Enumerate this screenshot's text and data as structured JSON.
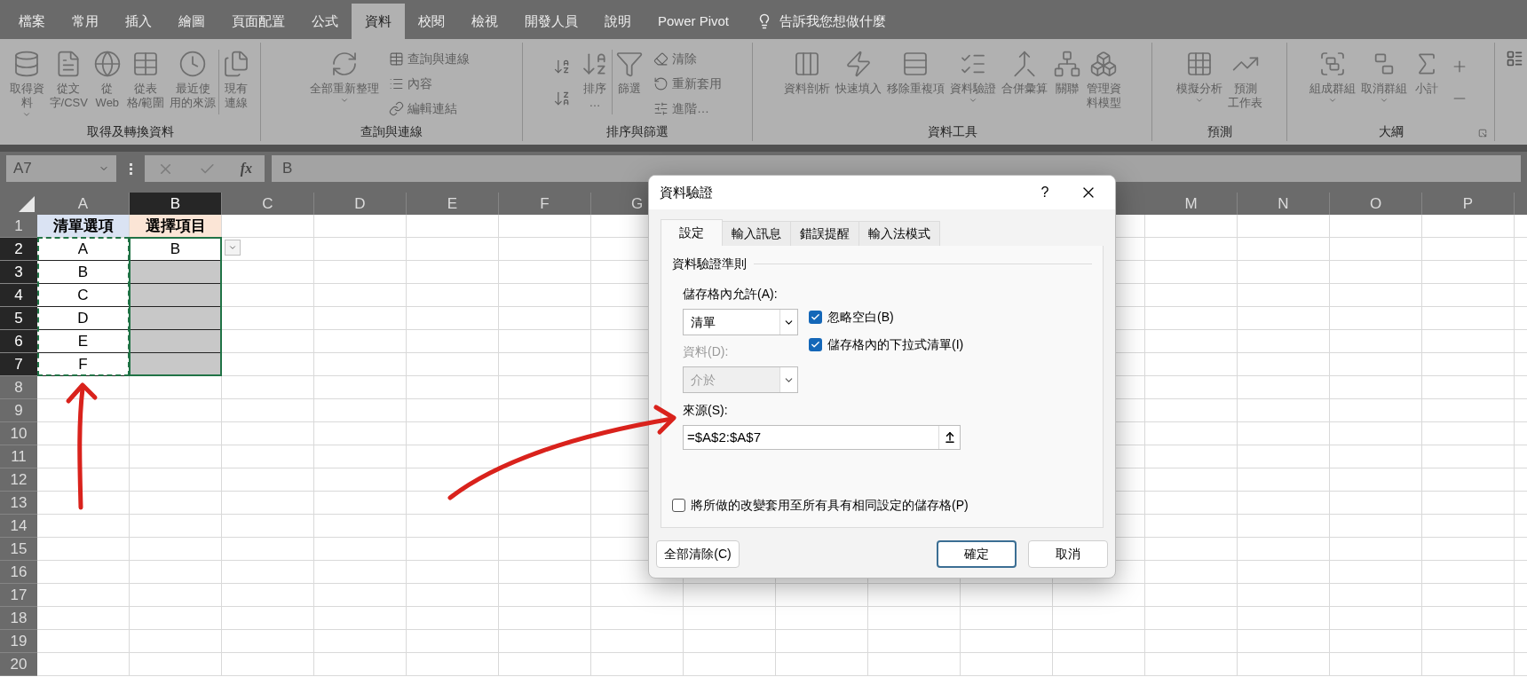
{
  "menu_tabs": [
    {
      "label": "檔案",
      "selected": false
    },
    {
      "label": "常用",
      "selected": false
    },
    {
      "label": "插入",
      "selected": false
    },
    {
      "label": "繪圖",
      "selected": false
    },
    {
      "label": "頁面配置",
      "selected": false
    },
    {
      "label": "公式",
      "selected": false
    },
    {
      "label": "資料",
      "selected": true
    },
    {
      "label": "校閱",
      "selected": false
    },
    {
      "label": "檢視",
      "selected": false
    },
    {
      "label": "開發人員",
      "selected": false
    },
    {
      "label": "說明",
      "selected": false
    },
    {
      "label": "Power Pivot",
      "selected": false
    }
  ],
  "tell_me": "告訴我您想做什麼",
  "ribbon_groups": [
    {
      "label": "取得及轉換資料",
      "launcher": false,
      "items": [
        {
          "kind": "large",
          "lines": [
            "取得資",
            "料"
          ],
          "dropdown": true
        },
        {
          "kind": "large",
          "lines": [
            "從文",
            "字/CSV"
          ],
          "dropdown": false
        },
        {
          "kind": "large",
          "lines": [
            "從",
            "Web"
          ],
          "dropdown": false
        },
        {
          "kind": "large",
          "lines": [
            "從表",
            "格/範圍"
          ],
          "dropdown": false
        },
        {
          "kind": "large",
          "lines": [
            "最近使",
            "用的來源"
          ],
          "dropdown": false
        },
        {
          "kind": "separator"
        },
        {
          "kind": "large",
          "lines": [
            "現有",
            "連線"
          ],
          "dropdown": false
        }
      ]
    },
    {
      "label": "查詢與連線",
      "launcher": false,
      "items": [
        {
          "kind": "large",
          "lines": [
            "全部重新整理"
          ],
          "dropdown": true
        },
        {
          "kind": "stack",
          "entries": [
            "查詢與連線",
            "內容",
            "編輯連結"
          ]
        }
      ]
    },
    {
      "label": "排序與篩選",
      "launcher": false,
      "items": [
        {
          "kind": "icon_stack"
        },
        {
          "kind": "large",
          "lines": [
            "排序",
            "…"
          ],
          "dropdown": false
        },
        {
          "kind": "separator"
        },
        {
          "kind": "large",
          "lines": [
            "篩選"
          ],
          "dropdown": false
        },
        {
          "kind": "stack",
          "entries": [
            "清除",
            "重新套用",
            "進階…"
          ]
        }
      ]
    },
    {
      "label": "資料工具",
      "launcher": false,
      "items": [
        {
          "kind": "large",
          "lines": [
            "資料剖析"
          ],
          "dropdown": false
        },
        {
          "kind": "large",
          "lines": [
            "快速填入"
          ],
          "dropdown": false
        },
        {
          "kind": "large",
          "lines": [
            "移除重複項"
          ],
          "dropdown": false
        },
        {
          "kind": "large",
          "lines": [
            "資料驗證"
          ],
          "dropdown": true
        },
        {
          "kind": "large",
          "lines": [
            "合併彙算"
          ],
          "dropdown": false
        },
        {
          "kind": "large",
          "lines": [
            "關聯"
          ],
          "dropdown": false
        },
        {
          "kind": "large",
          "lines": [
            "管理資",
            "料模型"
          ],
          "dropdown": false
        }
      ]
    },
    {
      "label": "預測",
      "launcher": false,
      "items": [
        {
          "kind": "large",
          "lines": [
            "模擬分析"
          ],
          "dropdown": true
        },
        {
          "kind": "large",
          "lines": [
            "預測",
            "工作表"
          ],
          "dropdown": false
        }
      ]
    },
    {
      "label": "大綱",
      "launcher": true,
      "items": [
        {
          "kind": "large",
          "lines": [
            "組成群組"
          ],
          "dropdown": true
        },
        {
          "kind": "large",
          "lines": [
            "取消群組"
          ],
          "dropdown": true
        },
        {
          "kind": "large",
          "lines": [
            "小計"
          ],
          "dropdown": false
        },
        {
          "kind": "icon_stack"
        }
      ]
    }
  ],
  "name_box": "A7",
  "fx": "fx",
  "formula": "B",
  "sheet": {
    "columns": [
      {
        "label": "A",
        "selected": false
      },
      {
        "label": "B",
        "selected": true
      },
      {
        "label": "C",
        "selected": false
      },
      {
        "label": "D",
        "selected": false
      },
      {
        "label": "E",
        "selected": false
      },
      {
        "label": "F",
        "selected": false
      },
      {
        "label": "G",
        "selected": false
      }
    ],
    "columns_right": [
      {
        "label": "M",
        "selected": false
      },
      {
        "label": "N",
        "selected": false
      },
      {
        "label": "O",
        "selected": false
      },
      {
        "label": "P",
        "selected": false
      }
    ],
    "rows": [
      {
        "label": "1",
        "selected": false,
        "cells": [
          {
            "text": "清單選項",
            "color": "#dae3f3"
          },
          {
            "text": "選擇項目",
            "color": "#fbe5d6"
          }
        ]
      },
      {
        "label": "2",
        "selected": true,
        "cells": [
          {
            "text": "A"
          },
          {
            "text": "B"
          }
        ]
      },
      {
        "label": "3",
        "selected": true,
        "cells": [
          {
            "text": "B"
          },
          {
            "color": "#c8c8c8"
          }
        ]
      },
      {
        "label": "4",
        "selected": true,
        "cells": [
          {
            "text": "C"
          },
          {
            "color": "#c8c8c8"
          }
        ]
      },
      {
        "label": "5",
        "selected": true,
        "cells": [
          {
            "text": "D"
          },
          {
            "color": "#c8c8c8"
          }
        ]
      },
      {
        "label": "6",
        "selected": true,
        "cells": [
          {
            "text": "E"
          },
          {
            "color": "#c8c8c8"
          }
        ]
      },
      {
        "label": "7",
        "selected": true,
        "cells": [
          {
            "text": "F"
          },
          {
            "color": "#c8c8c8"
          }
        ]
      },
      {
        "label": "8",
        "selected": false
      },
      {
        "label": "9",
        "selected": false
      },
      {
        "label": "10",
        "selected": false
      },
      {
        "label": "11",
        "selected": false
      },
      {
        "label": "12",
        "selected": false
      },
      {
        "label": "13",
        "selected": false
      },
      {
        "label": "14",
        "selected": false
      },
      {
        "label": "15",
        "selected": false
      },
      {
        "label": "16",
        "selected": false
      },
      {
        "label": "17",
        "selected": false
      },
      {
        "label": "18",
        "selected": false
      },
      {
        "label": "19",
        "selected": false
      },
      {
        "label": "20",
        "selected": false
      }
    ]
  },
  "dialog": {
    "title": "資料驗證",
    "help": "?",
    "tabs": [
      {
        "label": "設定",
        "selected": true
      },
      {
        "label": "輸入訊息",
        "selected": false
      },
      {
        "label": "錯誤提醒",
        "selected": false
      },
      {
        "label": "輸入法模式",
        "selected": false
      }
    ],
    "section": "資料驗證準則",
    "allow_label": "儲存格內允許(A):",
    "allow_value": "清單",
    "data_label": "資料(D):",
    "data_value": "介於",
    "data_disabled": true,
    "checkboxes": [
      {
        "label": "忽略空白(B)",
        "checked": true
      },
      {
        "label": "儲存格內的下拉式清單(I)",
        "checked": true
      }
    ],
    "source_label": "來源(S):",
    "source_value": "=$A$2:$A$7",
    "apply_all": {
      "label": "將所做的改變套用至所有具有相同設定的儲存格(P)",
      "checked": false
    },
    "buttons": [
      {
        "label": "全部清除(C)",
        "default": false
      },
      {
        "label": "確定",
        "default": true
      },
      {
        "label": "取消",
        "default": false
      }
    ]
  }
}
